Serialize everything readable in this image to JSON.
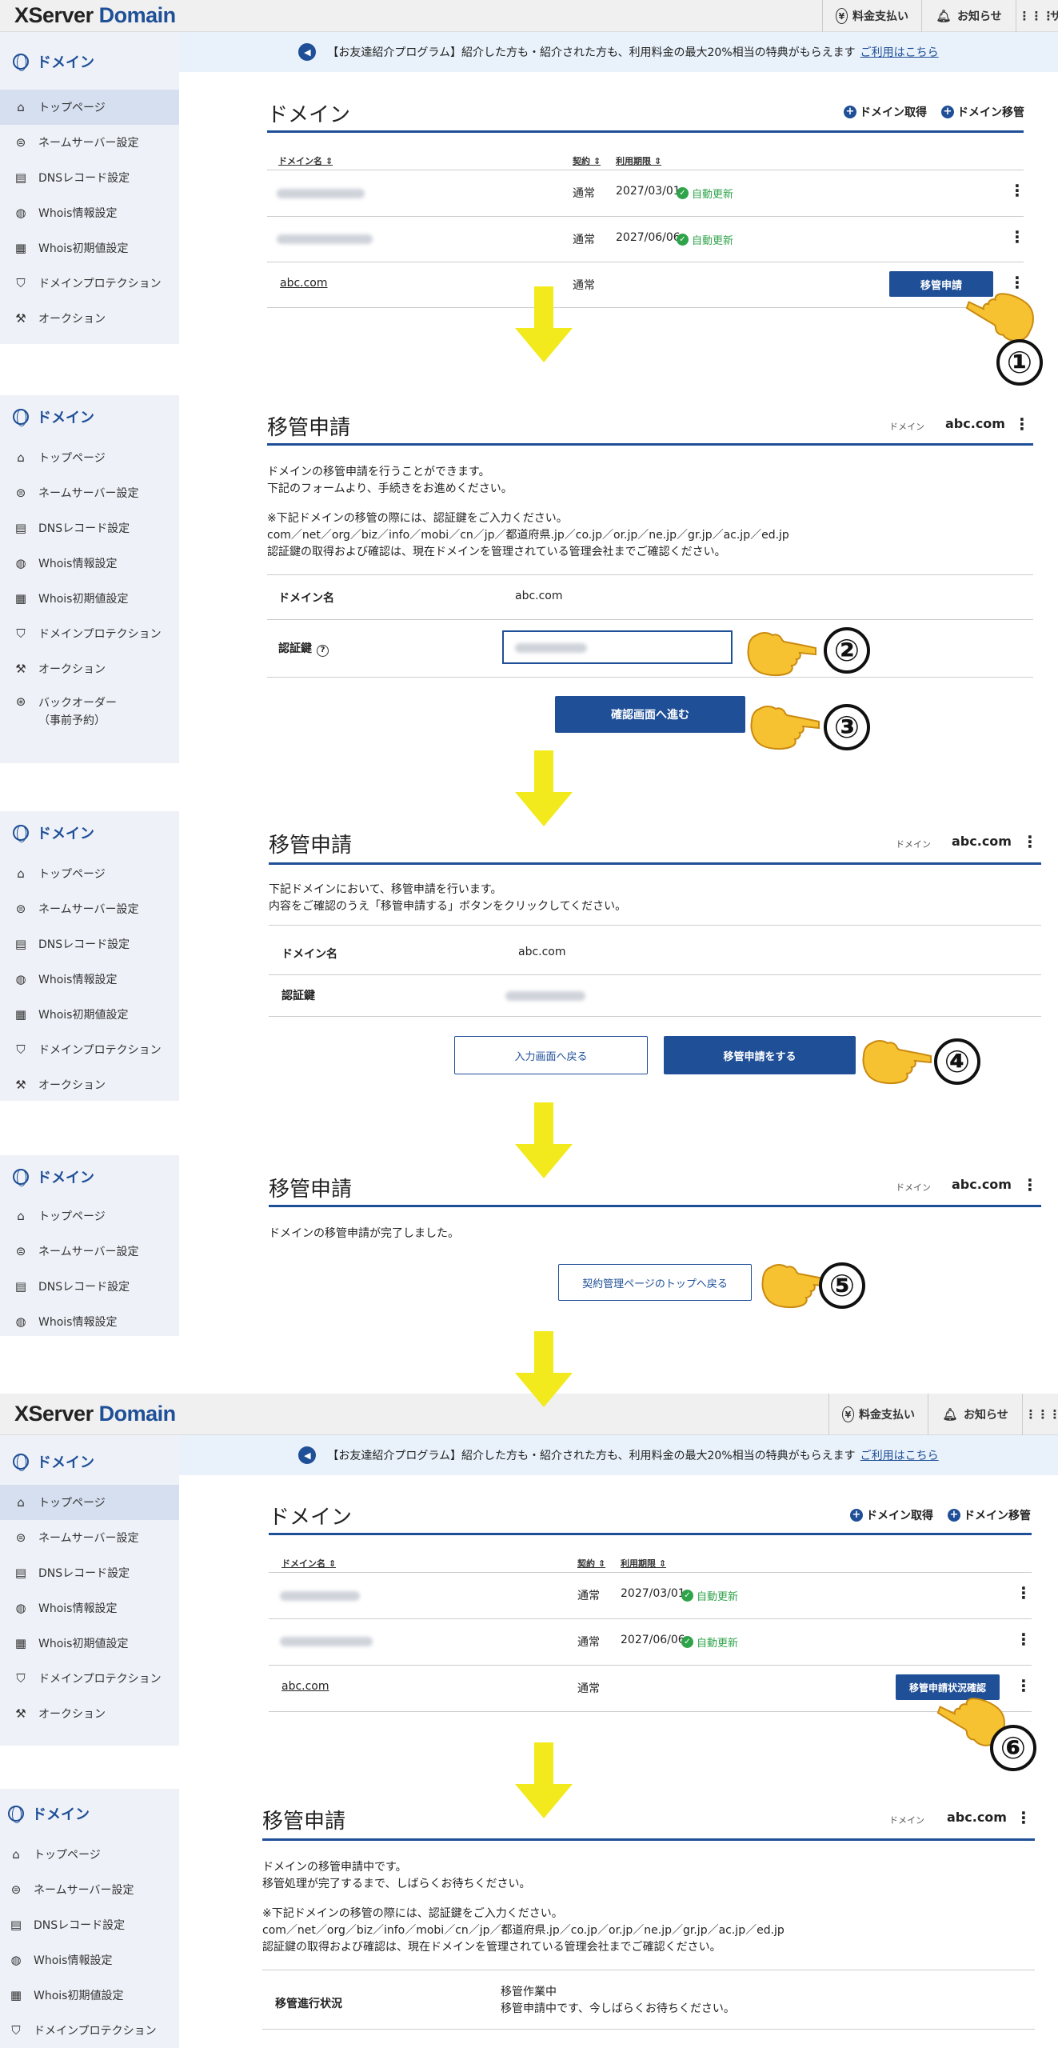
{
  "brand": {
    "x": "XServer",
    "domain": "Domain"
  },
  "topnav": {
    "pay": "料金支払い",
    "notice": "お知らせ",
    "service": "サ"
  },
  "banner": {
    "text": "【お友達紹介プログラム】紹介した方も・紹介された方も、利用料金の最大20%相当の特典がもらえます",
    "link": "ご利用はこちら"
  },
  "sidebar": {
    "head": "ドメイン",
    "items": [
      "トップページ",
      "ネームサーバー設定",
      "DNSレコード設定",
      "Whois情報設定",
      "Whois初期値設定",
      "ドメインプロテクション",
      "オークション"
    ],
    "backorder": "バックオーダー",
    "backorder_sub": "（事前予約）"
  },
  "list": {
    "title": "ドメイン",
    "acquire": "ドメイン取得",
    "transfer": "ドメイン移管",
    "col_domain": "ドメイン名 ⇕",
    "col_contract": "契約 ⇕",
    "col_expiry": "利用期限 ⇕",
    "rows": [
      {
        "contract": "通常",
        "expiry": "2027/03/01",
        "renew": "自動更新"
      },
      {
        "contract": "通常",
        "expiry": "2027/06/06",
        "renew": "自動更新"
      },
      {
        "name": "abc.com",
        "contract": "通常"
      }
    ],
    "btn_apply": "移管申請",
    "btn_status": "移管申請状況確認"
  },
  "transfer": {
    "title": "移管申請",
    "domain_label": "ドメイン",
    "domain": "abc.com",
    "intro1": "ドメインの移管申請を行うことができます。",
    "intro2": "下記のフォームより、手続きをお進めください。",
    "note1": "※下記ドメインの移管の際には、認証鍵をご入力ください。",
    "note2": "com／net／org／biz／info／mobi／cn／jp／都道府県.jp／co.jp／or.jp／ne.jp／gr.jp／ac.jp／ed.jp",
    "note3": "認証鍵の取得および確認は、現在ドメインを管理されている管理会社までご確認ください。",
    "field_domain": "ドメイン名",
    "field_key": "認証鍵",
    "help": "?",
    "btn_confirm": "確認画面へ進む",
    "confirm1": "下記ドメインにおいて、移管申請を行います。",
    "confirm2": "内容をご確認のうえ「移管申請する」ボタンをクリックしてください。",
    "btn_back": "入力画面へ戻る",
    "btn_submit": "移管申請をする",
    "done": "ドメインの移管申請が完了しました。",
    "btn_top": "契約管理ページのトップへ戻る",
    "pending1": "ドメインの移管申請中です。",
    "pending2": "移管処理が完了するまで、しばらくお待ちください。",
    "status_label": "移管進行状況",
    "status1": "移管作業中",
    "status2": "移管申請中です、今しばらくお待ちください。"
  },
  "steps": [
    "①",
    "②",
    "③",
    "④",
    "⑤",
    "⑥"
  ],
  "colors": {
    "brand_blue": "#1f4f97",
    "arrow_yellow": "#f2ea1c",
    "renew_green": "#2fa34a"
  }
}
